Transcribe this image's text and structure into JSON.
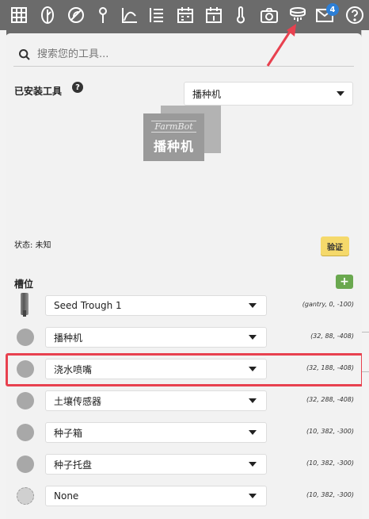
{
  "nav": {
    "icons": [
      "grid-icon",
      "plants-icon",
      "weeds-icon",
      "points-icon",
      "curves-icon",
      "sequences-icon",
      "regimens-icon",
      "farmware-icon",
      "sensors-icon",
      "photos-icon",
      "tools-icon",
      "messages-icon",
      "help-icon"
    ],
    "messages_badge": "4",
    "colors": {
      "icon": "#ffffff",
      "badge": "#2d7fd6",
      "arrow": "#e8414f"
    }
  },
  "search": {
    "placeholder": "搜索您的工具..."
  },
  "installed_tool": {
    "label": "已安装工具",
    "help": "?",
    "selected": "播种机",
    "image_brand": "FarmBot",
    "image_name": "播种机"
  },
  "status": {
    "text": "状态: 未知",
    "verify_button": "验证",
    "verify_color": "#f5d96b"
  },
  "slots": {
    "label": "槽位",
    "add_button": "+",
    "add_color": "#6aa84f",
    "items": [
      {
        "tool": "Seed Trough 1",
        "coords": "(gantry, 0, -100)",
        "icon": "seed-trough-icon"
      },
      {
        "tool": "播种机",
        "coords": "(32, 88, -408)",
        "icon": "slot-circle-icon"
      },
      {
        "tool": "浇水喷嘴",
        "coords": "(32, 188, -408)",
        "icon": "slot-circle-icon"
      },
      {
        "tool": "土壤传感器",
        "coords": "(32, 288, -408)",
        "icon": "slot-circle-icon"
      },
      {
        "tool": "种子箱",
        "coords": "(10, 382, -300)",
        "icon": "slot-circle-icon"
      },
      {
        "tool": "种子托盘",
        "coords": "(10, 382, -300)",
        "icon": "slot-circle-icon"
      },
      {
        "tool": "None",
        "coords": "(10, 382, -300)",
        "icon": "empty-slot-icon"
      }
    ],
    "highlight_color": "#e8414f"
  }
}
